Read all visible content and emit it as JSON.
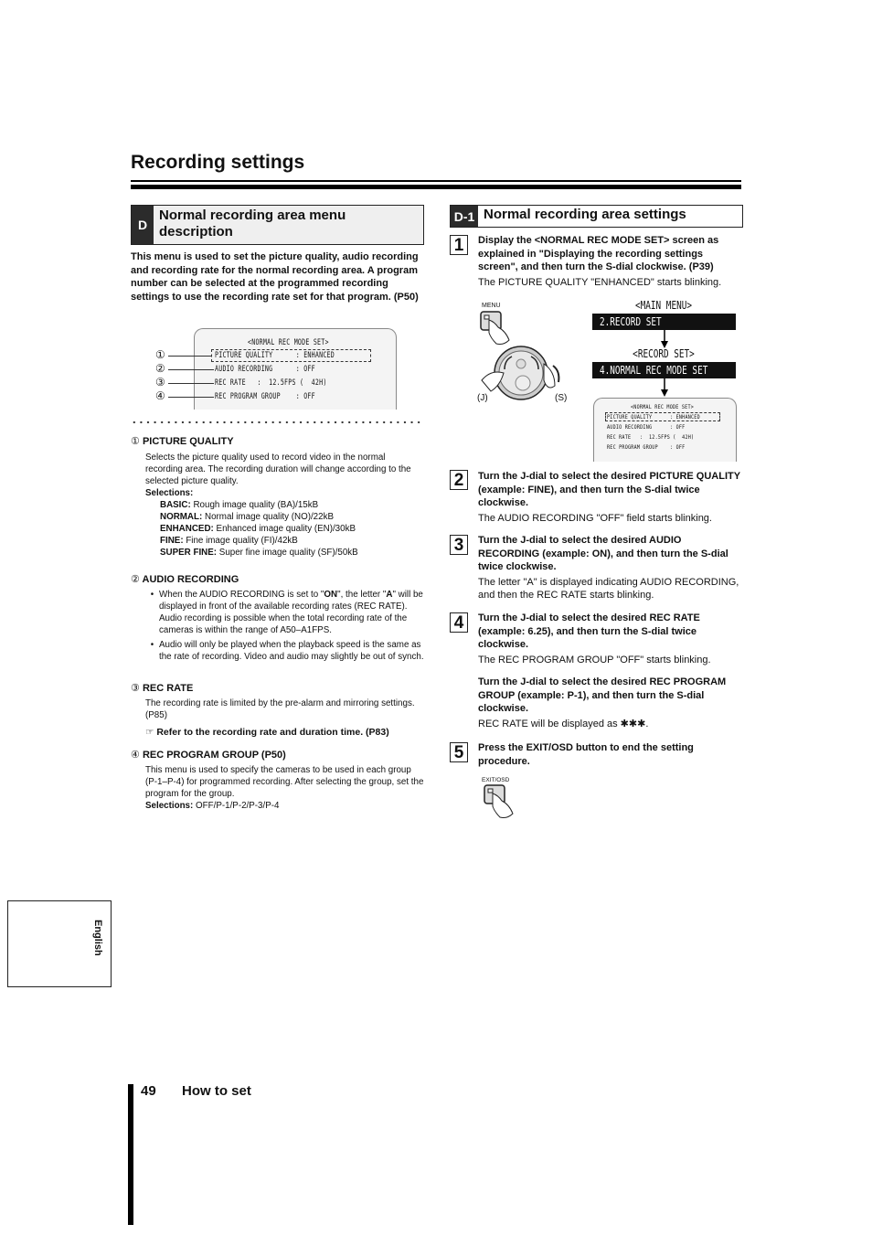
{
  "page": {
    "title": "Recording settings",
    "page_number": "49",
    "section_footer": "How to set",
    "language_tab": "English"
  },
  "left": {
    "badge": "D",
    "heading": "Normal recording area menu description",
    "intro": "This menu is used to set the picture quality, audio recording and recording rate for the normal recording area. A program number can be selected at the programmed recording settings to use the recording rate set for that program. (P50)",
    "osd": {
      "title": "<NORMAL REC MODE SET>",
      "lines": [
        {
          "num": "①",
          "text": "PICTURE QUALITY      : ENHANCED"
        },
        {
          "num": "②",
          "text": "AUDIO RECORDING      : OFF"
        },
        {
          "num": "③",
          "text": "REC RATE   :  12.5FPS (  42H)"
        },
        {
          "num": "④",
          "text": "REC PROGRAM GROUP    : OFF"
        }
      ]
    },
    "items": [
      {
        "num": "①",
        "title": "PICTURE QUALITY",
        "text": "Selects the picture quality used to record video in the normal recording area. The recording duration will change according to the selected picture quality.",
        "selections_label": "Selections:",
        "selections": [
          {
            "label": "BASIC:",
            "text": "Rough image quality (BA)/15kB"
          },
          {
            "label": "NORMAL:",
            "text": "Normal image quality (NO)/22kB"
          },
          {
            "label": "ENHANCED:",
            "text": "Enhanced image quality (EN)/30kB"
          },
          {
            "label": "FINE:",
            "text": "Fine image quality (FI)/42kB"
          },
          {
            "label": "SUPER FINE:",
            "text": "Super fine image quality (SF)/50kB"
          }
        ]
      },
      {
        "num": "②",
        "title": "AUDIO RECORDING",
        "bullets": [
          {
            "pre": "When the AUDIO RECORDING is set to \"",
            "b1": "ON",
            "mid": "\", the letter \"",
            "b2": "A",
            "post": "\" will be displayed in front of the available recording rates (REC RATE). Audio recording is possible when the total recording rate of the cameras is within the range of A50–A1FPS."
          },
          {
            "text": "Audio will only be played when the playback speed is the same as the rate of recording. Video and audio may slightly be out of synch."
          }
        ]
      },
      {
        "num": "③",
        "title": "REC RATE",
        "text": "The recording rate is limited by the pre-alarm and mirroring settings. (P85)",
        "ref_icon": "☞",
        "ref": "Refer to the recording rate and duration time. (P83)"
      },
      {
        "num": "④",
        "title": "REC PROGRAM GROUP (P50)",
        "text": "This menu is used to specify the cameras to be used in each group (P-1–P-4) for programmed recording. After selecting the group, set the program for the group.",
        "selections_label": "Selections:",
        "selections_text": "OFF/P-1/P-2/P-3/P-4"
      }
    ]
  },
  "right": {
    "badge": "D-1",
    "heading": "Normal recording area settings",
    "steps": [
      {
        "num": "1",
        "bold": "Display the <NORMAL REC MODE SET> screen as explained in \"Displaying the recording settings screen\", and then turn the S-dial clockwise. (P39)",
        "text": "The PICTURE QUALITY \"ENHANCED\" starts blinking."
      },
      {
        "num": "2",
        "bold": "Turn the J-dial to select the desired PICTURE QUALITY (example: FINE), and then turn the S-dial twice clockwise.",
        "text": "The AUDIO RECORDING \"OFF\" field starts blinking."
      },
      {
        "num": "3",
        "bold": "Turn the J-dial to select the desired AUDIO RECORDING (example: ON), and then turn the S-dial twice clockwise.",
        "text": "The letter \"A\" is displayed indicating AUDIO RECORDING, and then the REC RATE starts blinking."
      },
      {
        "num": "4",
        "bold": "Turn the J-dial to select the desired REC RATE (example: 6.25), and then turn the S-dial twice clockwise.",
        "text": "The REC PROGRAM GROUP \"OFF\" starts blinking.",
        "bold2": "Turn the J-dial to select the desired REC PROGRAM GROUP (example: P-1), and then turn the S-dial clockwise.",
        "text2": "REC RATE will be displayed as ✱✱✱."
      },
      {
        "num": "5",
        "bold": "Press the EXIT/OSD button to end the setting procedure."
      }
    ],
    "diagram": {
      "menu_button": "MENU",
      "j_label": "(J)",
      "s_label": "(S)",
      "main_menu": "<MAIN MENU>",
      "main_item": "2.RECORD SET",
      "record_set": "<RECORD SET>",
      "record_item": "4.NORMAL REC MODE SET",
      "osd_title": "<NORMAL REC MODE SET>",
      "osd_lines": [
        "PICTURE QUALITY      : ENHANCED",
        "AUDIO RECORDING      : OFF",
        "REC RATE   :  12.5FPS (  42H)",
        "REC PROGRAM GROUP    : OFF"
      ],
      "exit_button": "EXIT/OSD"
    }
  }
}
